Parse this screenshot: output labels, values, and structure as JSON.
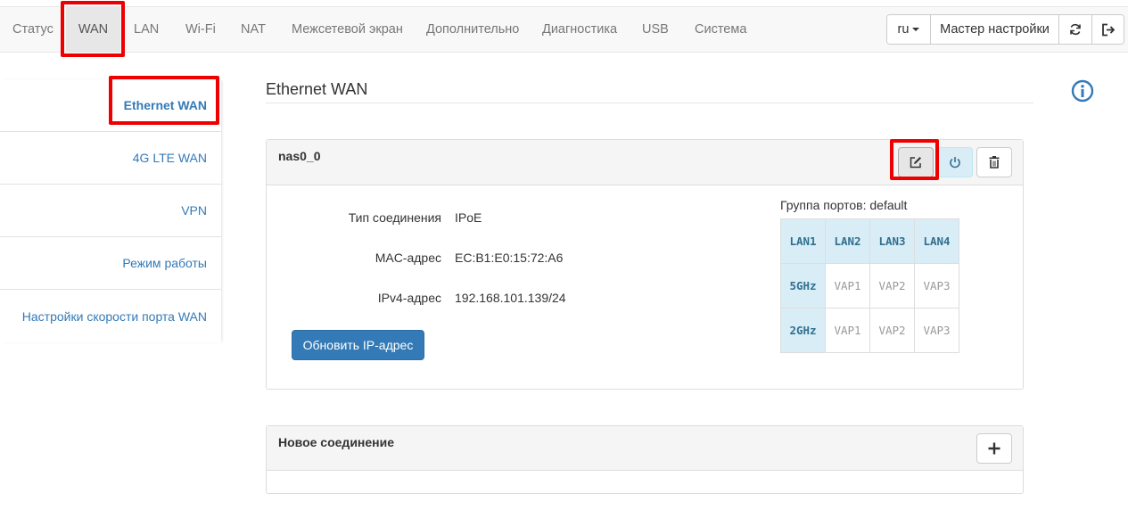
{
  "nav": {
    "items": [
      "Статус",
      "WAN",
      "LAN",
      "Wi-Fi",
      "NAT",
      "Межсетевой экран",
      "Дополнительно",
      "Диагностика",
      "USB",
      "Система"
    ],
    "lang": "ru",
    "wizard": "Мастер настройки",
    "refresh_icon": "refresh-icon",
    "logout_icon": "logout-icon"
  },
  "sidebar": {
    "items": [
      "Ethernet WAN",
      "4G LTE WAN",
      "VPN",
      "Режим работы",
      "Настройки скорости порта WAN"
    ]
  },
  "page": {
    "title": "Ethernet WAN",
    "info_icon": "info-icon"
  },
  "connection": {
    "name": "nas0_0",
    "fields": [
      {
        "label": "Тип соединения",
        "value": "IPoE"
      },
      {
        "label": "MAC-адрес",
        "value": "EC:B1:E0:15:72:A6"
      },
      {
        "label": "IPv4-адрес",
        "value": "192.168.101.139/24"
      }
    ],
    "refresh_button": "Обновить IP-адрес",
    "ports_caption": "Группа портов: default",
    "ports": [
      [
        "LAN1",
        "LAN2",
        "LAN3",
        "LAN4"
      ],
      [
        "5GHz",
        "VAP1",
        "VAP2",
        "VAP3"
      ],
      [
        "2GHz",
        "VAP1",
        "VAP2",
        "VAP3"
      ]
    ],
    "highlighted_ports": [
      "LAN1",
      "LAN2",
      "LAN3",
      "LAN4",
      "5GHz",
      "2GHz"
    ]
  },
  "new_connection": {
    "title": "Новое соединение"
  },
  "colors": {
    "link": "#337ab7",
    "highlight": "#ee0000",
    "port_active_bg": "#d9edf7"
  }
}
